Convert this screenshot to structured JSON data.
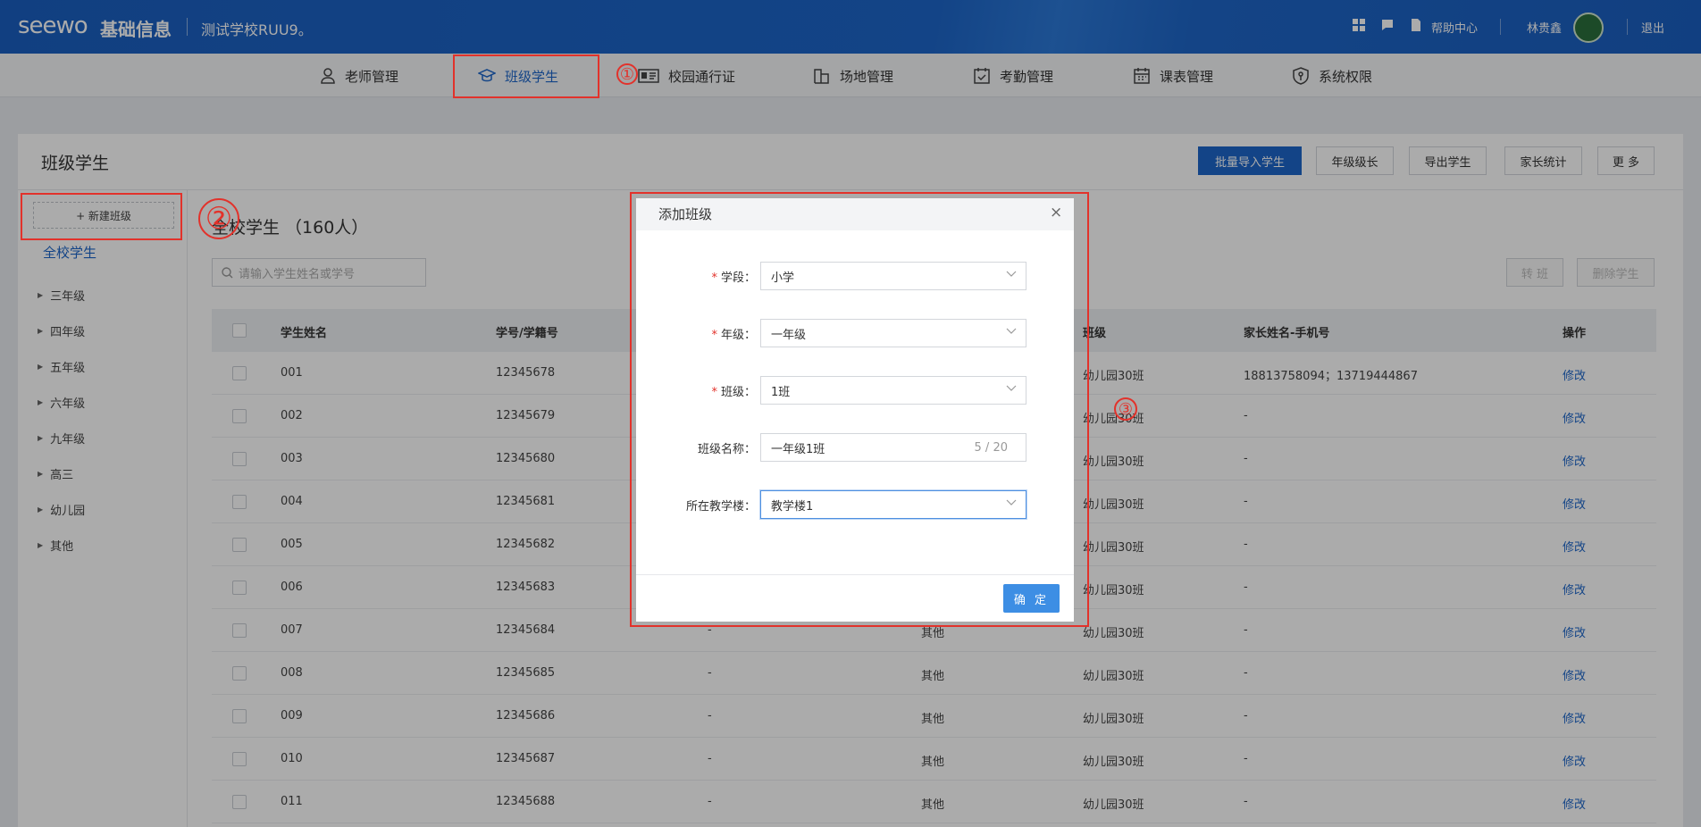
{
  "topbar": {
    "logo": "seewo",
    "logo_sub": "基础信息",
    "school": "测试学校RUU9。",
    "help": "帮助中心",
    "user": "林贵鑫",
    "logout": "退出"
  },
  "nav": [
    {
      "label": "老师管理"
    },
    {
      "label": "班级学生"
    },
    {
      "label": "校园通行证"
    },
    {
      "label": "场地管理"
    },
    {
      "label": "考勤管理"
    },
    {
      "label": "课表管理"
    },
    {
      "label": "系统权限"
    }
  ],
  "page": {
    "title": "班级学生",
    "buttons": [
      "批量导入学生",
      "年级级长",
      "导出学生",
      "家长统计",
      "更 多"
    ],
    "new_class": "+ 新建班级",
    "all_students": "全校学生",
    "grades": [
      "三年级",
      "四年级",
      "五年级",
      "六年级",
      "九年级",
      "高三",
      "幼儿园",
      "其他"
    ],
    "main_title": "全校学生 （160人）",
    "search_placeholder": "请输入学生姓名或学号",
    "transfer": "转 班",
    "delete": "删除学生"
  },
  "table": {
    "headers": [
      "学生姓名",
      "学号/学籍号",
      "班级",
      "家长姓名-手机号",
      "操作"
    ],
    "rows": [
      {
        "name": "001",
        "id": "12345678",
        "c3": "",
        "c4": "",
        "class": "幼儿园30班",
        "parent": "18813758094；13719444867",
        "op": "修改"
      },
      {
        "name": "002",
        "id": "12345679",
        "c3": "",
        "c4": "",
        "class": "幼儿园30班",
        "parent": "-",
        "op": "修改"
      },
      {
        "name": "003",
        "id": "12345680",
        "c3": "",
        "c4": "",
        "class": "幼儿园30班",
        "parent": "-",
        "op": "修改"
      },
      {
        "name": "004",
        "id": "12345681",
        "c3": "",
        "c4": "",
        "class": "幼儿园30班",
        "parent": "-",
        "op": "修改"
      },
      {
        "name": "005",
        "id": "12345682",
        "c3": "",
        "c4": "",
        "class": "幼儿园30班",
        "parent": "-",
        "op": "修改"
      },
      {
        "name": "006",
        "id": "12345683",
        "c3": "",
        "c4": "",
        "class": "幼儿园30班",
        "parent": "-",
        "op": "修改"
      },
      {
        "name": "007",
        "id": "12345684",
        "c3": "-",
        "c4": "其他",
        "class": "幼儿园30班",
        "parent": "-",
        "op": "修改"
      },
      {
        "name": "008",
        "id": "12345685",
        "c3": "-",
        "c4": "其他",
        "class": "幼儿园30班",
        "parent": "-",
        "op": "修改"
      },
      {
        "name": "009",
        "id": "12345686",
        "c3": "-",
        "c4": "其他",
        "class": "幼儿园30班",
        "parent": "-",
        "op": "修改"
      },
      {
        "name": "010",
        "id": "12345687",
        "c3": "-",
        "c4": "其他",
        "class": "幼儿园30班",
        "parent": "-",
        "op": "修改"
      },
      {
        "name": "011",
        "id": "12345688",
        "c3": "-",
        "c4": "其他",
        "class": "幼儿园30班",
        "parent": "-",
        "op": "修改"
      }
    ]
  },
  "modal": {
    "title": "添加班级",
    "close": "×",
    "fields": [
      {
        "label": "学段：",
        "value": "小学",
        "required": "*"
      },
      {
        "label": "年级：",
        "value": "一年级",
        "required": "*"
      },
      {
        "label": "班级：",
        "value": "1班",
        "required": "*"
      },
      {
        "label": "班级名称：",
        "value": "一年级1班",
        "count": "5 / 20"
      },
      {
        "label": "所在教学楼：",
        "value": "教学楼1"
      }
    ],
    "ok": "确 定"
  },
  "annotations": [
    "①",
    "②",
    "③"
  ],
  "colors": {
    "brand": "#1d66c9",
    "annotation": "#e2322b",
    "ok_button": "#3d8ee4"
  }
}
